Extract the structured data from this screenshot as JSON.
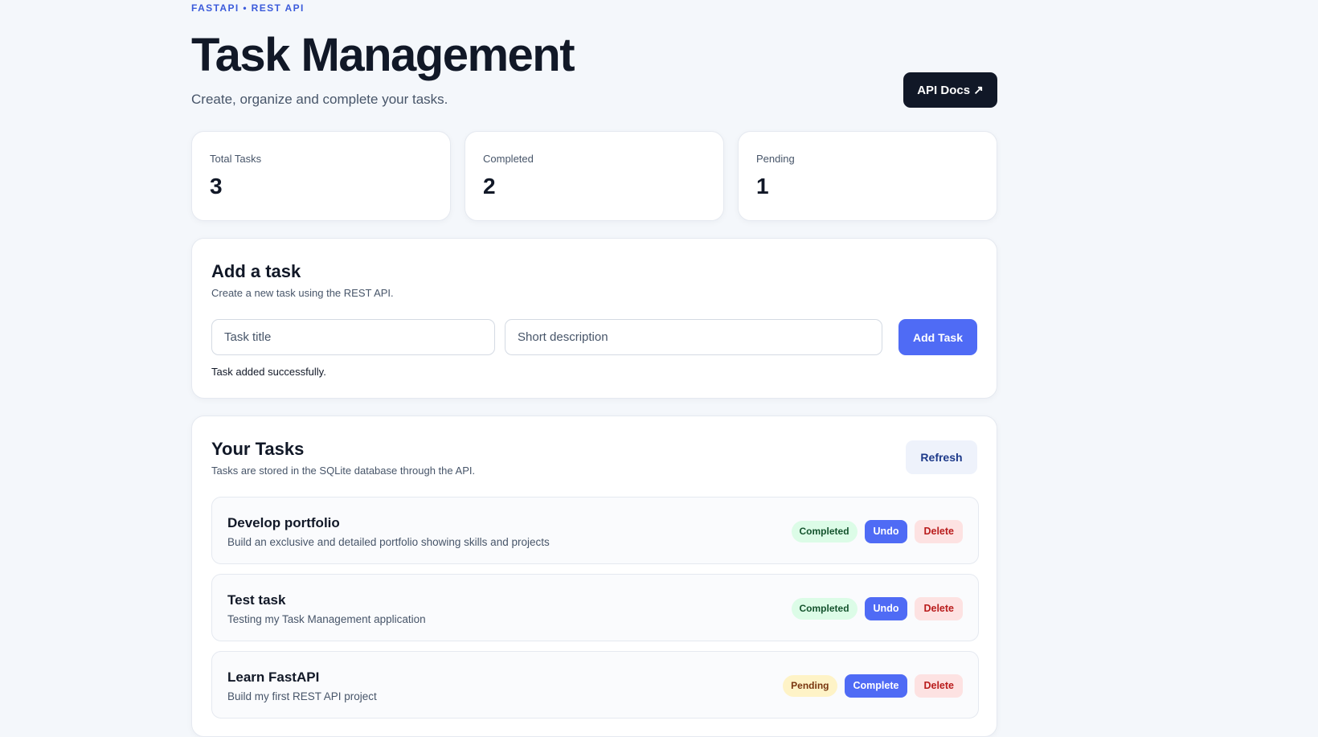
{
  "header": {
    "eyebrow": "FASTAPI • REST API",
    "title": "Task Management",
    "subtitle": "Create, organize and complete your tasks.",
    "docs_label": "API Docs ↗"
  },
  "stats": [
    {
      "label": "Total Tasks",
      "value": "3"
    },
    {
      "label": "Completed",
      "value": "2"
    },
    {
      "label": "Pending",
      "value": "1"
    }
  ],
  "add_task": {
    "title": "Add a task",
    "description": "Create a new task using the REST API.",
    "title_placeholder": "Task title",
    "desc_placeholder": "Short description",
    "submit_label": "Add Task",
    "message": "Task added successfully."
  },
  "tasks_section": {
    "title": "Your Tasks",
    "description": "Tasks are stored in the SQLite database through the API.",
    "refresh_label": "Refresh",
    "delete_label": "Delete",
    "items": [
      {
        "title": "Develop portfolio",
        "description": "Build an exclusive and detailed portfolio showing skills and projects",
        "status": "Completed",
        "action": "Undo"
      },
      {
        "title": "Test task",
        "description": "Testing my Task Management application",
        "status": "Completed",
        "action": "Undo"
      },
      {
        "title": "Learn FastAPI",
        "description": "Build my first REST API project",
        "status": "Pending",
        "action": "Complete"
      }
    ]
  },
  "colors": {
    "accent": "#4f6bf5",
    "dark": "#111827",
    "success_bg": "#dcfce7",
    "pending_bg": "#fef3c7",
    "danger_bg": "#fde2e2"
  }
}
